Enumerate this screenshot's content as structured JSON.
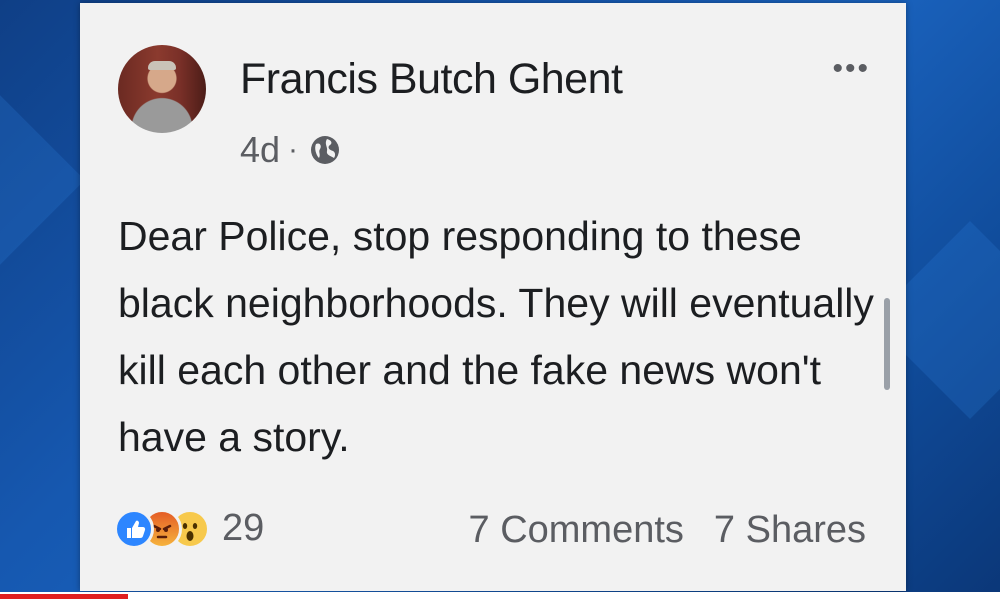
{
  "post": {
    "author": "Francis Butch Ghent",
    "time": "4d",
    "separator": "·",
    "privacy_icon": "globe-icon",
    "menu_icon": "more-options-icon",
    "menu_glyph": "•••",
    "text": "Dear Police, stop responding to these black neighborhoods. They will eventually kill each other and the fake news won't have a story.",
    "reactions": {
      "icons": [
        "like-icon",
        "angry-icon",
        "wow-icon"
      ],
      "count": "29"
    },
    "comments": "7 Comments",
    "shares": "7 Shares"
  },
  "colors": {
    "background": "#1658b0",
    "card": "#f2f2f2",
    "like": "#2d86ff",
    "progress": "#e01f1f"
  }
}
